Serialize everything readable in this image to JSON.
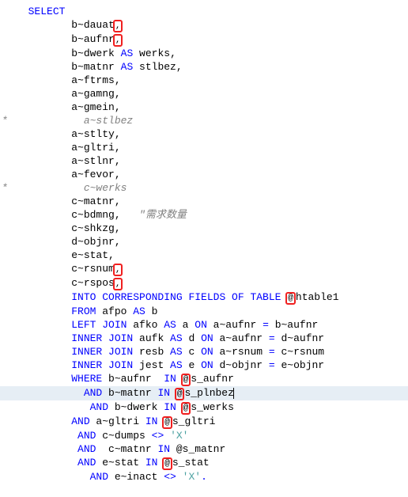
{
  "lines": [
    {
      "indent": "  ",
      "tokens": [
        {
          "t": "SELECT",
          "c": "kw"
        }
      ]
    },
    {
      "indent": "         ",
      "tokens": [
        {
          "t": "b~dauat",
          "c": "id"
        },
        {
          "mark": ","
        },
        {
          "t": "",
          "c": "op"
        }
      ]
    },
    {
      "indent": "         ",
      "tokens": [
        {
          "t": "b~aufnr",
          "c": "id"
        },
        {
          "mark": ","
        }
      ]
    },
    {
      "indent": "         ",
      "tokens": [
        {
          "t": "b~dwerk ",
          "c": "id"
        },
        {
          "t": "AS",
          "c": "kw"
        },
        {
          "t": " werks",
          "c": "id"
        },
        {
          "t": ",",
          "c": "op"
        }
      ]
    },
    {
      "indent": "         ",
      "tokens": [
        {
          "t": "b~matnr ",
          "c": "id"
        },
        {
          "t": "AS",
          "c": "kw"
        },
        {
          "t": " stlbez",
          "c": "id"
        },
        {
          "t": ",",
          "c": "op"
        }
      ]
    },
    {
      "indent": "         ",
      "tokens": [
        {
          "t": "a~ftrms",
          "c": "id"
        },
        {
          "t": ",",
          "c": "op"
        }
      ]
    },
    {
      "indent": "         ",
      "tokens": [
        {
          "t": "a~gamng",
          "c": "id"
        },
        {
          "t": ",",
          "c": "op"
        }
      ]
    },
    {
      "indent": "         ",
      "tokens": [
        {
          "t": "a~gmein",
          "c": "id"
        },
        {
          "t": ",",
          "c": "op"
        }
      ]
    },
    {
      "gutter": "*",
      "indent": "           ",
      "tokens": [
        {
          "t": "a~stlbez",
          "c": "cm"
        }
      ]
    },
    {
      "indent": "         ",
      "tokens": [
        {
          "t": "a~stlty",
          "c": "id"
        },
        {
          "t": ",",
          "c": "op"
        }
      ]
    },
    {
      "indent": "         ",
      "tokens": [
        {
          "t": "a~gltri",
          "c": "id"
        },
        {
          "t": ",",
          "c": "op"
        }
      ]
    },
    {
      "indent": "         ",
      "tokens": [
        {
          "t": "a~stlnr",
          "c": "id"
        },
        {
          "t": ",",
          "c": "op"
        }
      ]
    },
    {
      "indent": "         ",
      "tokens": [
        {
          "t": "a~fevor",
          "c": "id"
        },
        {
          "t": ",",
          "c": "op"
        }
      ]
    },
    {
      "gutter": "*",
      "indent": "           ",
      "tokens": [
        {
          "t": "c~werks",
          "c": "cm"
        }
      ]
    },
    {
      "indent": "         ",
      "tokens": [
        {
          "t": "c~matnr",
          "c": "id"
        },
        {
          "t": ",",
          "c": "op"
        }
      ]
    },
    {
      "indent": "         ",
      "tokens": [
        {
          "t": "c~bdmng",
          "c": "id"
        },
        {
          "t": ",   ",
          "c": "op"
        },
        {
          "t": "\"需求数量",
          "c": "cm"
        }
      ]
    },
    {
      "indent": "         ",
      "tokens": [
        {
          "t": "c~shkzg",
          "c": "id"
        },
        {
          "t": ",",
          "c": "op"
        }
      ]
    },
    {
      "indent": "         ",
      "tokens": [
        {
          "t": "d~objnr",
          "c": "id"
        },
        {
          "t": ",",
          "c": "op"
        }
      ]
    },
    {
      "indent": "         ",
      "tokens": [
        {
          "t": "e~stat",
          "c": "id"
        },
        {
          "t": ",",
          "c": "op"
        }
      ]
    },
    {
      "indent": "         ",
      "tokens": [
        {
          "t": "c~rsnum",
          "c": "id"
        },
        {
          "mark": ","
        }
      ]
    },
    {
      "indent": "         ",
      "tokens": [
        {
          "t": "c~rspos",
          "c": "id"
        },
        {
          "mark": ","
        }
      ]
    },
    {
      "indent": "         ",
      "tokens": [
        {
          "t": "INTO CORRESPONDING FIELDS OF TABLE",
          "c": "kw"
        },
        {
          "t": " ",
          "c": "op"
        },
        {
          "mark": "@"
        },
        {
          "t": "htable1",
          "c": "id"
        }
      ]
    },
    {
      "indent": "         ",
      "tokens": [
        {
          "t": "FROM",
          "c": "kw"
        },
        {
          "t": " afpo ",
          "c": "id"
        },
        {
          "t": "AS",
          "c": "kw"
        },
        {
          "t": " b",
          "c": "id"
        }
      ]
    },
    {
      "indent": "         ",
      "tokens": [
        {
          "t": "LEFT JOIN",
          "c": "kw"
        },
        {
          "t": " afko ",
          "c": "id"
        },
        {
          "t": "AS",
          "c": "kw"
        },
        {
          "t": " a ",
          "c": "id"
        },
        {
          "t": "ON",
          "c": "kw"
        },
        {
          "t": " a~aufnr ",
          "c": "id"
        },
        {
          "t": "=",
          "c": "kw"
        },
        {
          "t": " b~aufnr",
          "c": "id"
        }
      ]
    },
    {
      "indent": "         ",
      "tokens": [
        {
          "t": "INNER JOIN",
          "c": "kw"
        },
        {
          "t": " aufk ",
          "c": "id"
        },
        {
          "t": "AS",
          "c": "kw"
        },
        {
          "t": " d ",
          "c": "id"
        },
        {
          "t": "ON",
          "c": "kw"
        },
        {
          "t": " a~aufnr ",
          "c": "id"
        },
        {
          "t": "=",
          "c": "kw"
        },
        {
          "t": " d~aufnr",
          "c": "id"
        }
      ]
    },
    {
      "indent": "         ",
      "tokens": [
        {
          "t": "INNER JOIN",
          "c": "kw"
        },
        {
          "t": " resb ",
          "c": "id"
        },
        {
          "t": "AS",
          "c": "kw"
        },
        {
          "t": " c ",
          "c": "id"
        },
        {
          "t": "ON",
          "c": "kw"
        },
        {
          "t": " a~rsnum ",
          "c": "id"
        },
        {
          "t": "=",
          "c": "kw"
        },
        {
          "t": " c~rsnum",
          "c": "id"
        }
      ]
    },
    {
      "indent": "         ",
      "tokens": [
        {
          "t": "INNER JOIN",
          "c": "kw"
        },
        {
          "t": " jest ",
          "c": "id"
        },
        {
          "t": "AS",
          "c": "kw"
        },
        {
          "t": " e ",
          "c": "id"
        },
        {
          "t": "ON",
          "c": "kw"
        },
        {
          "t": " d~objnr ",
          "c": "id"
        },
        {
          "t": "=",
          "c": "kw"
        },
        {
          "t": " e~objnr",
          "c": "id"
        }
      ]
    },
    {
      "indent": "         ",
      "tokens": [
        {
          "t": "WHERE",
          "c": "kw"
        },
        {
          "t": " b~aufnr  ",
          "c": "id"
        },
        {
          "t": "IN",
          "c": "kw"
        },
        {
          "t": " ",
          "c": "op"
        },
        {
          "mark": "@"
        },
        {
          "t": "s_aufnr",
          "c": "id"
        }
      ]
    },
    {
      "hl": true,
      "indent": "           ",
      "tokens": [
        {
          "t": "AND",
          "c": "kw"
        },
        {
          "t": " b~matnr ",
          "c": "id"
        },
        {
          "t": "IN",
          "c": "kw"
        },
        {
          "t": " ",
          "c": "op"
        },
        {
          "mark": "@"
        },
        {
          "t": "s_plnbez",
          "c": "id"
        },
        {
          "cursor": true
        }
      ]
    },
    {
      "indent": "            ",
      "tokens": [
        {
          "t": "AND",
          "c": "kw"
        },
        {
          "t": " b~dwerk ",
          "c": "id"
        },
        {
          "t": "IN",
          "c": "kw"
        },
        {
          "t": " ",
          "c": "op"
        },
        {
          "mark": "@"
        },
        {
          "t": "s_werks",
          "c": "id"
        }
      ]
    },
    {
      "indent": "         ",
      "tokens": [
        {
          "t": "AND",
          "c": "kw"
        },
        {
          "t": " a~gltri ",
          "c": "id"
        },
        {
          "t": "IN",
          "c": "kw"
        },
        {
          "t": " ",
          "c": "op"
        },
        {
          "mark": "@"
        },
        {
          "t": "s_gltri",
          "c": "id"
        }
      ]
    },
    {
      "indent": "          ",
      "tokens": [
        {
          "t": "AND",
          "c": "kw"
        },
        {
          "t": " c~dumps ",
          "c": "id"
        },
        {
          "t": "<>",
          "c": "kw"
        },
        {
          "t": " ",
          "c": "op"
        },
        {
          "t": "'X'",
          "c": "str"
        }
      ]
    },
    {
      "indent": "          ",
      "tokens": [
        {
          "t": "AND",
          "c": "kw"
        },
        {
          "t": "  c~matnr ",
          "c": "id"
        },
        {
          "t": "IN",
          "c": "kw"
        },
        {
          "t": " @s_matnr",
          "c": "id"
        }
      ]
    },
    {
      "indent": "          ",
      "tokens": [
        {
          "t": "AND",
          "c": "kw"
        },
        {
          "t": " e~stat ",
          "c": "id"
        },
        {
          "t": "IN",
          "c": "kw"
        },
        {
          "t": " ",
          "c": "op"
        },
        {
          "mark": "@"
        },
        {
          "t": "s_stat",
          "c": "id"
        }
      ]
    },
    {
      "indent": "            ",
      "tokens": [
        {
          "t": "AND",
          "c": "kw"
        },
        {
          "t": " e~inact ",
          "c": "id"
        },
        {
          "t": "<>",
          "c": "kw"
        },
        {
          "t": " ",
          "c": "op"
        },
        {
          "t": "'X'",
          "c": "str"
        },
        {
          "t": ".",
          "c": "kw"
        }
      ]
    }
  ]
}
